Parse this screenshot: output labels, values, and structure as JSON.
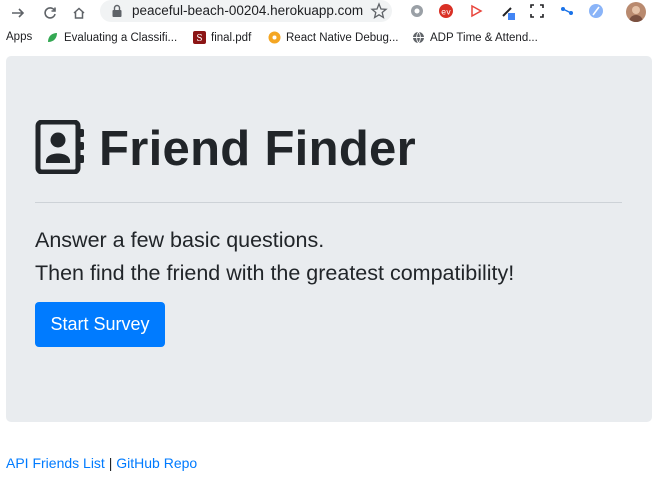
{
  "browser": {
    "url": "peaceful-beach-00204.herokuapp.com"
  },
  "bookmarks": [
    {
      "label": "Apps"
    },
    {
      "label": "Evaluating a Classifi..."
    },
    {
      "label": "final.pdf"
    },
    {
      "label": "React Native Debug..."
    },
    {
      "label": "ADP Time & Attend..."
    }
  ],
  "hero": {
    "title": "Friend Finder",
    "line1": "Answer a few basic questions.",
    "line2": "Then find the friend with the greatest compatibility!",
    "button_label": "Start Survey"
  },
  "footer": {
    "link1": "API Friends List",
    "separator": " | ",
    "link2": "GitHub Repo"
  },
  "colors": {
    "primary": "#007bff",
    "jumbotron_bg": "#e9ecef",
    "text": "#212529"
  }
}
